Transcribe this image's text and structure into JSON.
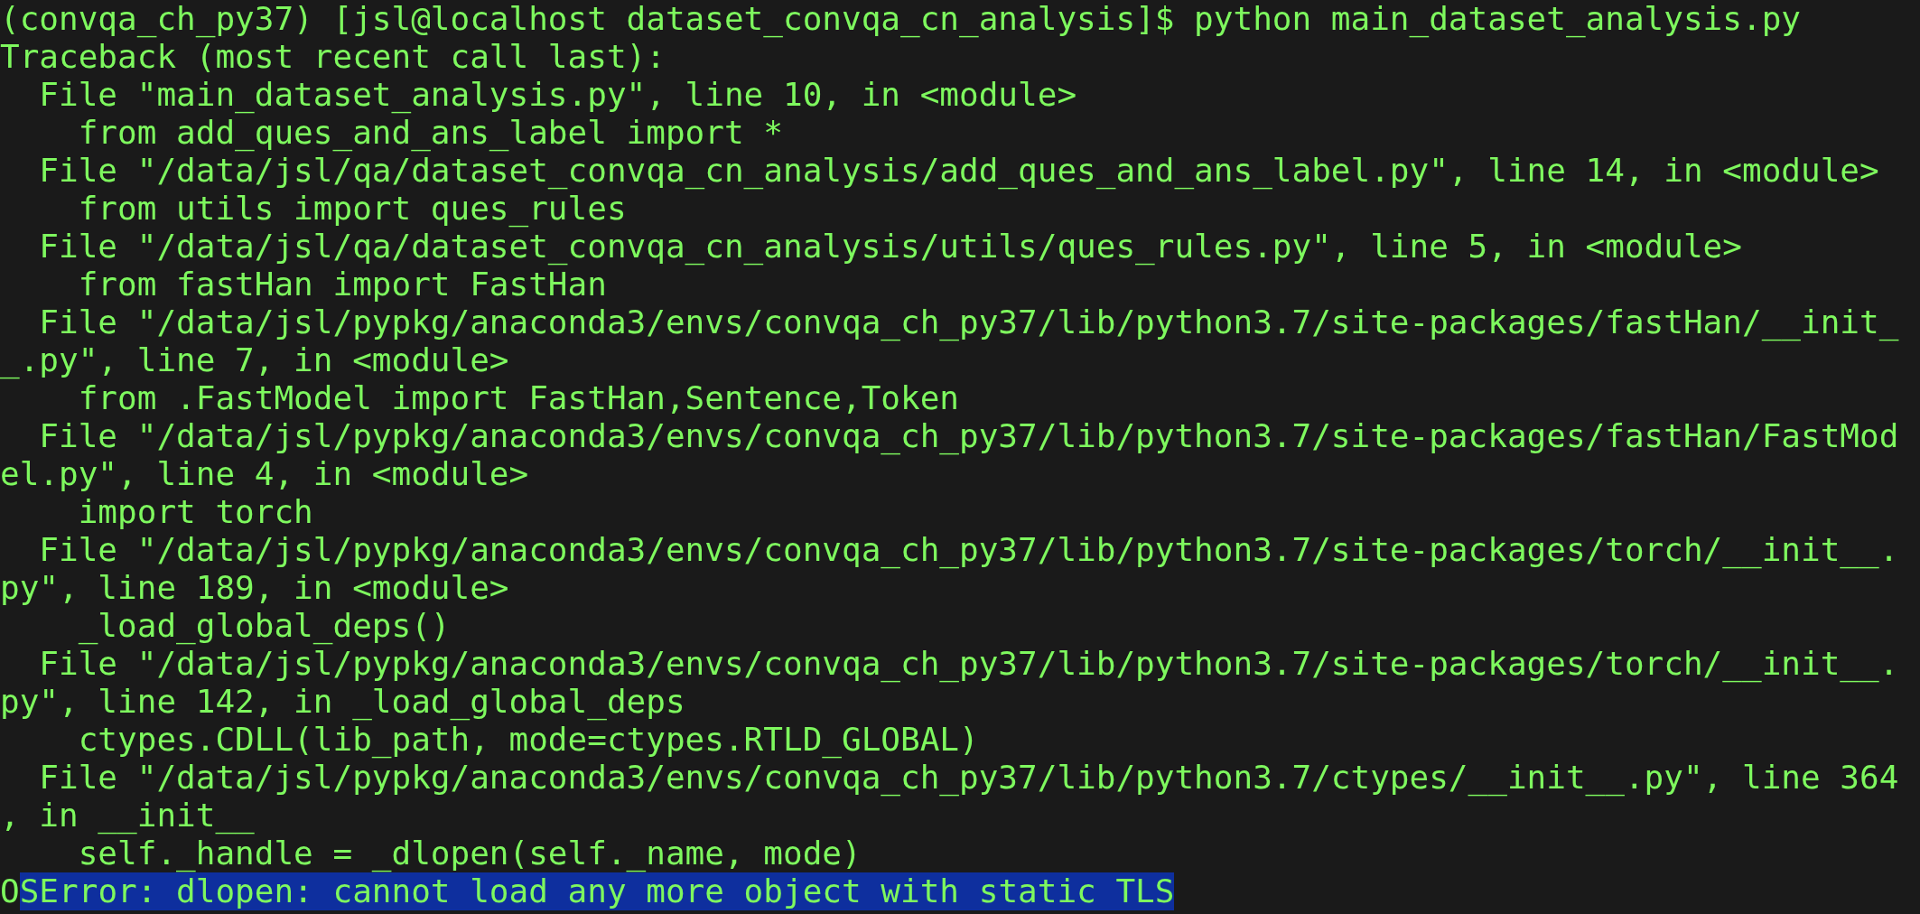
{
  "terminal": {
    "lines": [
      {
        "segments": [
          {
            "text": "(convqa_ch_py37) [jsl@localhost dataset_convqa_cn_analysis]$ python main_dataset_analysis.py",
            "selected": false
          }
        ]
      },
      {
        "segments": [
          {
            "text": "Traceback (most recent call last):",
            "selected": false
          }
        ]
      },
      {
        "segments": [
          {
            "text": "  File \"main_dataset_analysis.py\", line 10, in <module>",
            "selected": false
          }
        ]
      },
      {
        "segments": [
          {
            "text": "    from add_ques_and_ans_label import *",
            "selected": false
          }
        ]
      },
      {
        "segments": [
          {
            "text": "  File \"/data/jsl/qa/dataset_convqa_cn_analysis/add_ques_and_ans_label.py\", line 14, in <module>",
            "selected": false
          }
        ]
      },
      {
        "segments": [
          {
            "text": "    from utils import ques_rules",
            "selected": false
          }
        ]
      },
      {
        "segments": [
          {
            "text": "  File \"/data/jsl/qa/dataset_convqa_cn_analysis/utils/ques_rules.py\", line 5, in <module>",
            "selected": false
          }
        ]
      },
      {
        "segments": [
          {
            "text": "    from fastHan import FastHan",
            "selected": false
          }
        ]
      },
      {
        "segments": [
          {
            "text": "  File \"/data/jsl/pypkg/anaconda3/envs/convqa_ch_py37/lib/python3.7/site-packages/fastHan/__init_",
            "selected": false
          }
        ]
      },
      {
        "segments": [
          {
            "text": "_.py\", line 7, in <module>",
            "selected": false
          }
        ]
      },
      {
        "segments": [
          {
            "text": "    from .FastModel import FastHan,Sentence,Token",
            "selected": false
          }
        ]
      },
      {
        "segments": [
          {
            "text": "  File \"/data/jsl/pypkg/anaconda3/envs/convqa_ch_py37/lib/python3.7/site-packages/fastHan/FastMod",
            "selected": false
          }
        ]
      },
      {
        "segments": [
          {
            "text": "el.py\", line 4, in <module>",
            "selected": false
          }
        ]
      },
      {
        "segments": [
          {
            "text": "    import torch",
            "selected": false
          }
        ]
      },
      {
        "segments": [
          {
            "text": "  File \"/data/jsl/pypkg/anaconda3/envs/convqa_ch_py37/lib/python3.7/site-packages/torch/__init__.",
            "selected": false
          }
        ]
      },
      {
        "segments": [
          {
            "text": "py\", line 189, in <module>",
            "selected": false
          }
        ]
      },
      {
        "segments": [
          {
            "text": "    _load_global_deps()",
            "selected": false
          }
        ]
      },
      {
        "segments": [
          {
            "text": "  File \"/data/jsl/pypkg/anaconda3/envs/convqa_ch_py37/lib/python3.7/site-packages/torch/__init__.",
            "selected": false
          }
        ]
      },
      {
        "segments": [
          {
            "text": "py\", line 142, in _load_global_deps",
            "selected": false
          }
        ]
      },
      {
        "segments": [
          {
            "text": "    ctypes.CDLL(lib_path, mode=ctypes.RTLD_GLOBAL)",
            "selected": false
          }
        ]
      },
      {
        "segments": [
          {
            "text": "  File \"/data/jsl/pypkg/anaconda3/envs/convqa_ch_py37/lib/python3.7/ctypes/__init__.py\", line 364",
            "selected": false
          }
        ]
      },
      {
        "segments": [
          {
            "text": ", in __init__",
            "selected": false
          }
        ]
      },
      {
        "segments": [
          {
            "text": "    self._handle = _dlopen(self._name, mode)",
            "selected": false
          }
        ]
      },
      {
        "segments": [
          {
            "text": "O",
            "selected": false
          },
          {
            "text": "SError: dlopen: cannot load any more object with static TLS",
            "selected": true
          }
        ]
      }
    ]
  }
}
